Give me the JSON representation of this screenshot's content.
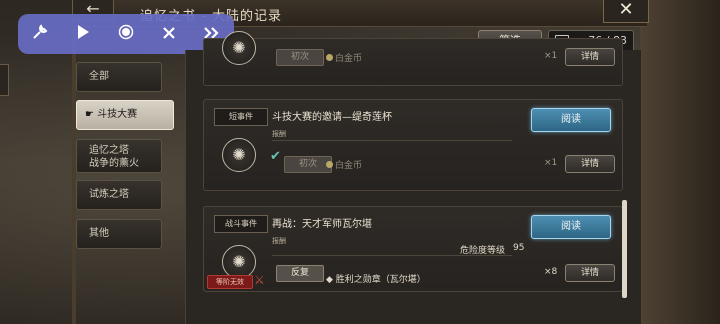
{
  "header": {
    "title": "追忆之书 - 大陆的记录",
    "back_icon": "←",
    "close_icon": "✕"
  },
  "toolbar": {
    "icons": [
      "wrench",
      "play",
      "record",
      "close",
      "fast-forward"
    ]
  },
  "filter": {
    "label": "筛选"
  },
  "counter": {
    "value": "76 / 83"
  },
  "sidebar": {
    "items": [
      {
        "label": "全部",
        "active": false
      },
      {
        "label": "斗技大赛",
        "active": true
      },
      {
        "label": "追忆之塔\n战争的薰火",
        "active": false
      },
      {
        "label": "试炼之塔",
        "active": false
      },
      {
        "label": "其他",
        "active": false
      }
    ]
  },
  "cards": [
    {
      "reward_state": "初次",
      "reward_name": "白金币",
      "quantity": "×1",
      "detail_label": "详情"
    },
    {
      "tag": "短事件",
      "title": "斗技大赛的邀请—缇奇莲杯",
      "reward_label": "报酬",
      "read_label": "阅读",
      "reward_state": "初次",
      "reward_name": "白金币",
      "quantity": "×1",
      "detail_label": "详情"
    },
    {
      "tag": "战斗事件",
      "title": "再战：天才军师瓦尔堪",
      "reward_label": "报酬",
      "read_label": "阅读",
      "danger_label": "危险度等级",
      "danger_value": "95",
      "reward_state": "反复",
      "reward_name": "胜利之勋章（瓦尔堪）",
      "quantity": "×8",
      "detail_label": "详情",
      "stamp": "等阶无效"
    }
  ]
}
